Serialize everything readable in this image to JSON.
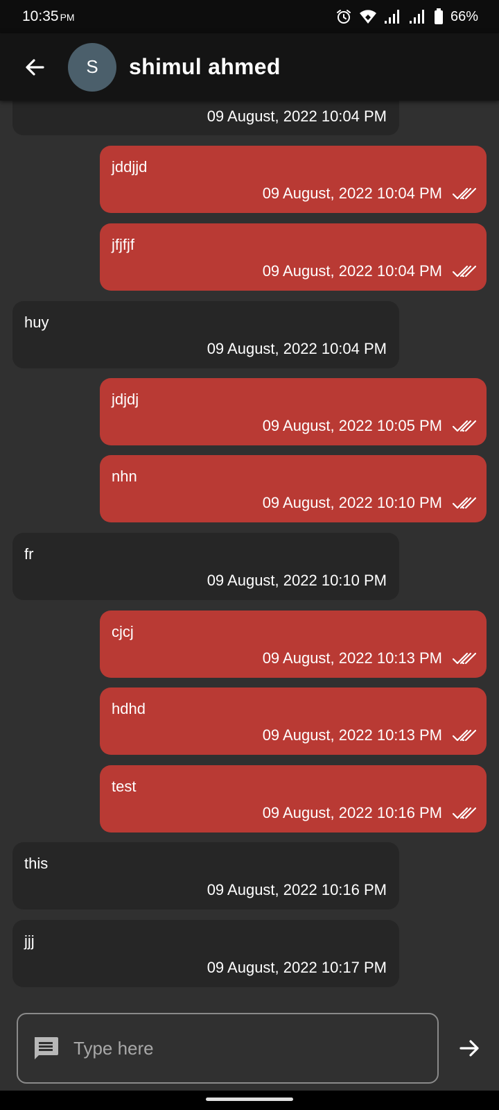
{
  "status_bar": {
    "time": "10:35",
    "ampm": "PM",
    "battery": "66%",
    "icons": [
      "alarm-icon",
      "wifi-icon",
      "signal-icon",
      "signal-icon",
      "battery-icon"
    ]
  },
  "header": {
    "avatar_letter": "S",
    "contact_name": "shimul ahmed",
    "back_icon": "arrow-left-icon"
  },
  "messages": [
    {
      "direction": "in",
      "text": "",
      "time": "09 August, 2022 10:04 PM"
    },
    {
      "direction": "out",
      "text": "jddjjd",
      "time": "09 August, 2022 10:04 PM",
      "status": "read"
    },
    {
      "direction": "out",
      "text": "jfjfjf",
      "time": "09 August, 2022 10:04 PM",
      "status": "read"
    },
    {
      "direction": "in",
      "text": "huy",
      "time": "09 August, 2022 10:04 PM"
    },
    {
      "direction": "out",
      "text": "jdjdj",
      "time": "09 August, 2022 10:05 PM",
      "status": "read"
    },
    {
      "direction": "out",
      "text": "nhn",
      "time": "09 August, 2022 10:10 PM",
      "status": "read"
    },
    {
      "direction": "in",
      "text": "fr",
      "time": "09 August, 2022 10:10 PM"
    },
    {
      "direction": "out",
      "text": "cjcj",
      "time": "09 August, 2022 10:13 PM",
      "status": "read"
    },
    {
      "direction": "out",
      "text": "hdhd",
      "time": "09 August, 2022 10:13 PM",
      "status": "read"
    },
    {
      "direction": "out",
      "text": "test",
      "time": "09 August, 2022 10:16 PM",
      "status": "read"
    },
    {
      "direction": "in",
      "text": "this",
      "time": "09 August, 2022 10:16 PM"
    },
    {
      "direction": "in",
      "text": "jjj",
      "time": "09 August, 2022 10:17 PM"
    }
  ],
  "composer": {
    "placeholder": "Type here",
    "value": "",
    "message_icon": "message-icon",
    "send_icon": "arrow-right-icon"
  },
  "colors": {
    "outgoing_bubble": "#b93a34",
    "incoming_bubble": "#262626",
    "background": "#303030",
    "app_bar": "#141414"
  }
}
